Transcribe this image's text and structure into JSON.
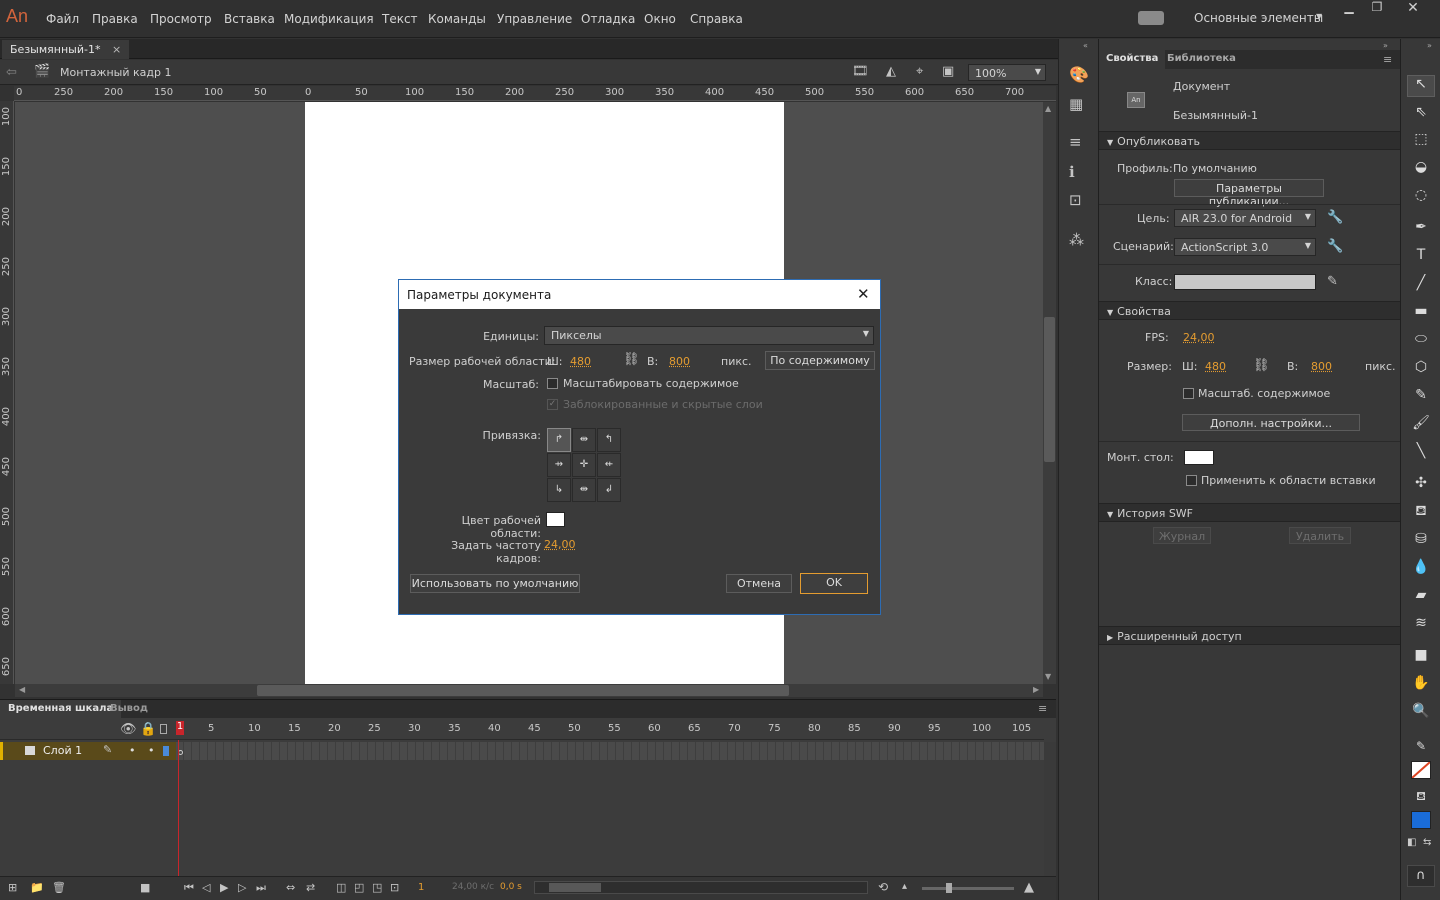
{
  "app": {
    "logo": "An",
    "workspace": "Основные элементы"
  },
  "menu": [
    "Файл",
    "Правка",
    "Просмотр",
    "Вставка",
    "Модификация",
    "Текст",
    "Команды",
    "Управление",
    "Отладка",
    "Окно",
    "Справка"
  ],
  "document_tab": {
    "title": "Безымянный-1*",
    "close": "×"
  },
  "editbar": {
    "scene": "Монтажный кадр 1",
    "zoom": "100%"
  },
  "ruler": {
    "h": [
      "0",
      "250",
      "200",
      "150",
      "100",
      "50",
      "0",
      "50",
      "100",
      "150",
      "200",
      "250",
      "300",
      "350",
      "400",
      "450",
      "500",
      "550",
      "600",
      "650",
      "700"
    ],
    "v": [
      "100",
      "150",
      "200",
      "250",
      "300",
      "350",
      "400",
      "450",
      "500",
      "550",
      "600",
      "650"
    ]
  },
  "dialog": {
    "title": "Параметры документа",
    "close": "✕",
    "units_label": "Единицы:",
    "units_value": "Пикселы",
    "size_label": "Размер рабочей области:",
    "w_label": "Ш:",
    "w_value": "480",
    "h_label": "В:",
    "h_value": "800",
    "px_label": "пикс.",
    "fit_button": "По содержимому",
    "scale_label": "Масштаб:",
    "scale_content": "Масштабировать содержимое",
    "locked_layers": "Заблокированные и скрытые слои",
    "anchor_label": "Привязка:",
    "stage_color_label": "Цвет рабочей области:",
    "fps_label": "Задать частоту кадров:",
    "fps_value": "24,00",
    "default_button": "Использовать по умолчанию",
    "cancel_button": "Отмена",
    "ok_button": "OK"
  },
  "timeline": {
    "tabs": [
      "Временная шкала",
      "Вывод"
    ],
    "layer_name": "Слой 1",
    "frame_numbers": [
      "1",
      "5",
      "10",
      "15",
      "20",
      "25",
      "30",
      "35",
      "40",
      "45",
      "50",
      "55",
      "60",
      "65",
      "70",
      "75",
      "80",
      "85",
      "90",
      "95",
      "100",
      "105"
    ],
    "footer_frame": "1",
    "footer_fps": "24,00 к/с",
    "footer_time": "0,0 s"
  },
  "props": {
    "tabs": [
      "Свойства",
      "Библиотека"
    ],
    "doc_type": "Документ",
    "doc_name": "Безымянный-1",
    "doc_icon_text": "An",
    "publish_header": "Опубликовать",
    "profile_label": "Профиль:",
    "profile_value": "По умолчанию",
    "publish_settings": "Параметры публикации...",
    "target_label": "Цель:",
    "target_value": "AIR 23.0 for Android",
    "script_label": "Сценарий:",
    "script_value": "ActionScript 3.0",
    "class_label": "Класс:",
    "properties_header": "Свойства",
    "fps_label": "FPS:",
    "fps_value": "24,00",
    "size_label": "Размер:",
    "w_label": "Ш:",
    "w_value": "480",
    "h_label": "В:",
    "h_value": "800",
    "px_label": "пикс.",
    "scale_content": "Масштаб. содержимое",
    "advanced_button": "Дополн. настройки...",
    "stage_label": "Монт. стол:",
    "apply_paste": "Применить к области вставки",
    "swf_history_header": "История SWF",
    "log_button": "Журнал",
    "delete_button": "Удалить",
    "accessibility_header": "Расширенный доступ"
  },
  "colors": {
    "accent": "#e49c30",
    "dialog_border": "#2d6cb3",
    "stage": "#ffffff",
    "layer_highlight": "#e0b000"
  }
}
